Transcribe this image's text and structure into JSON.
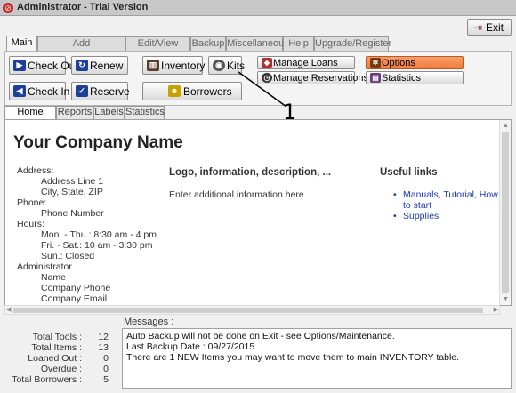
{
  "window": {
    "title": "Administrator - Trial Version",
    "exit_label": "Exit"
  },
  "main_tabs": [
    {
      "label": "Main",
      "active": true
    },
    {
      "label": "Add Items/Borrowers",
      "active": false
    },
    {
      "label": "Edit/View Table",
      "active": false
    },
    {
      "label": "Backup",
      "active": false
    },
    {
      "label": "Miscellaneous",
      "active": false
    },
    {
      "label": "Help",
      "active": false
    },
    {
      "label": "Upgrade/Register",
      "active": false
    }
  ],
  "toolbar": {
    "check_out": "Check Out",
    "renew": "Renew",
    "inventory": "Inventory",
    "kits": "Kits",
    "manage_loans": "Manage Loans",
    "options": "Options",
    "check_in": "Check In",
    "reserve": "Reserve",
    "borrowers": "Borrowers",
    "manage_reservations": "Manage Reservations",
    "statistics": "Statistics"
  },
  "annotation": "1",
  "sub_tabs": [
    {
      "label": "Home Page",
      "active": true
    },
    {
      "label": "Reports",
      "active": false
    },
    {
      "label": "Labels",
      "active": false
    },
    {
      "label": "Statistics",
      "active": false
    }
  ],
  "home": {
    "company_name": "Your Company Name",
    "address_label": "Address:",
    "address_lines": [
      "Address Line 1",
      "City, State, ZIP"
    ],
    "phone_label": "Phone:",
    "phone_value": "Phone Number",
    "hours_label": "Hours:",
    "hours_lines": [
      "Mon. - Thu.: 8:30 am - 4 pm",
      "Fri. - Sat.: 10 am - 3:30 pm",
      "Sun.: Closed"
    ],
    "admin_label": "Administrator",
    "admin_lines": [
      "Name",
      "Company Phone",
      "Company Email"
    ],
    "logo_heading": "Logo, information, description, ...",
    "logo_text": "Enter additional information here",
    "useful_links_heading": "Useful links",
    "links": [
      "Manuals, Tutorial, How to start",
      "Supplies"
    ]
  },
  "stats": [
    {
      "label": "Total Tools :",
      "value": "12"
    },
    {
      "label": "Total Items :",
      "value": "13"
    },
    {
      "label": "Loaned Out :",
      "value": "0"
    },
    {
      "label": "Overdue :",
      "value": "0"
    },
    {
      "label": "Total Borrowers :",
      "value": "5"
    }
  ],
  "messages": {
    "label": "Messages :",
    "lines": [
      "Auto Backup will not be done on Exit - see Options/Maintenance.",
      "Last Backup Date : 09/27/2015",
      "There are 1 NEW Items you may want to move them to main INVENTORY table."
    ]
  },
  "colors": {
    "options_accent": "#f07b3c",
    "link": "#1a3ab0"
  }
}
